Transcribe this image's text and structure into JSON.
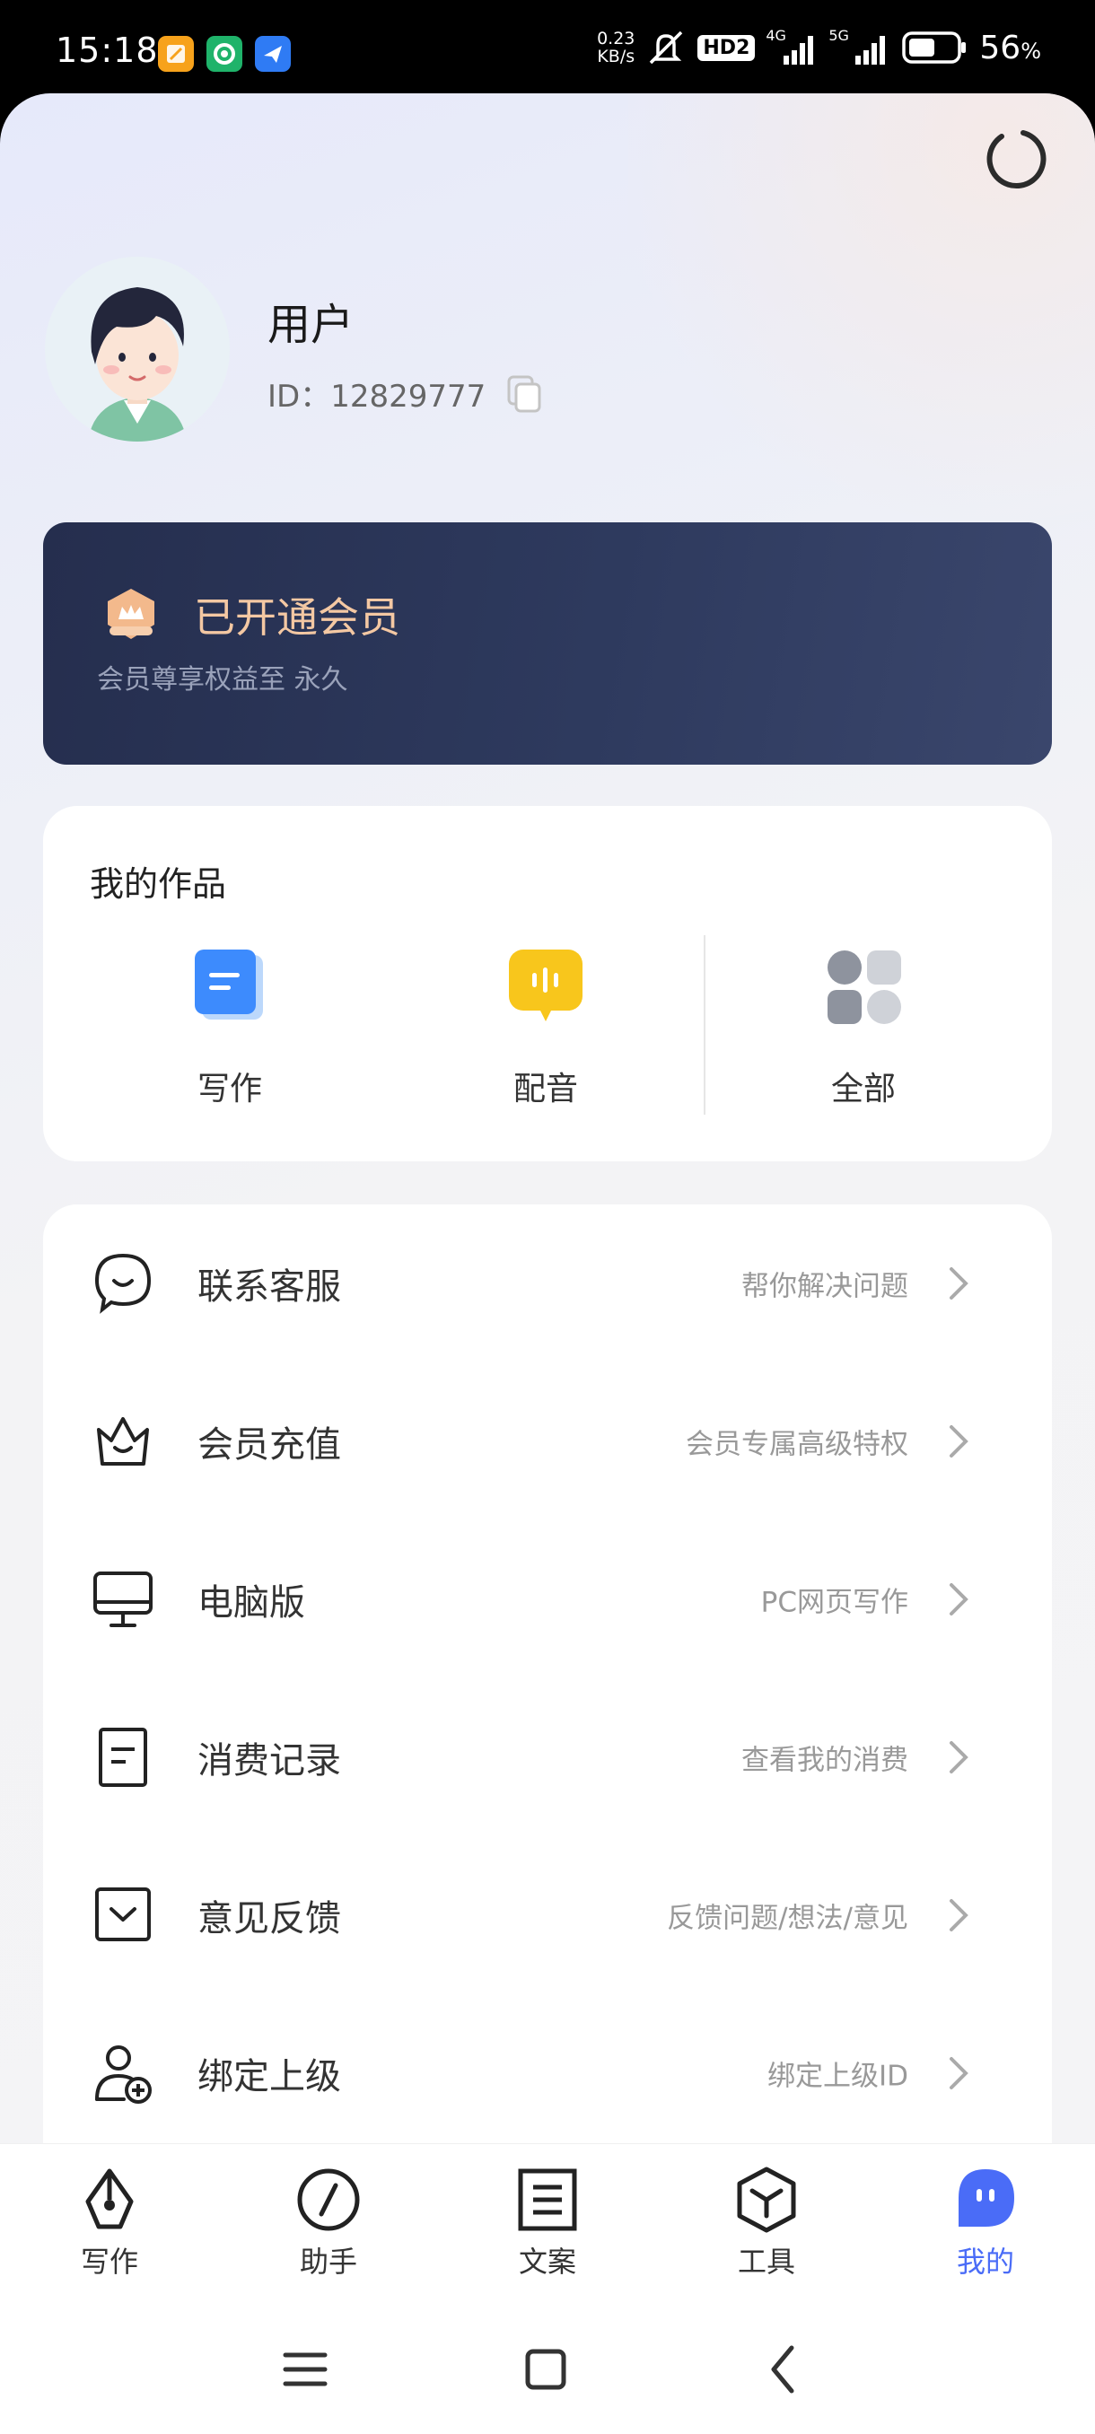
{
  "status_bar": {
    "time": "15:18",
    "net_speed_value": "0.23",
    "net_speed_unit": "KB/s",
    "hd_label": "HD2",
    "sig1_label": "4G",
    "sig2_label": "5G",
    "battery_value": "56",
    "battery_unit": "%",
    "battery_level": 0.56,
    "notification_icons": [
      "orange-app-icon",
      "green-app-icon",
      "blue-app-icon"
    ]
  },
  "profile": {
    "name": "用户",
    "id_text": "ID：12829777"
  },
  "member": {
    "title": "已开通会员",
    "subtitle": "会员尊享权益至 永久"
  },
  "works": {
    "title": "我的作品",
    "items": [
      {
        "label": "写作",
        "icon": "document-icon",
        "color": "#3d8bfd"
      },
      {
        "label": "配音",
        "icon": "audio-bubble-icon",
        "color": "#f8c61c"
      },
      {
        "label": "全部",
        "icon": "grid-icon",
        "color": "#8e939e"
      }
    ]
  },
  "menu": [
    {
      "label": "联系客服",
      "desc": "帮你解决问题",
      "icon": "chat-bubble-icon"
    },
    {
      "label": "会员充值",
      "desc": "会员专属高级特权",
      "icon": "crown-icon"
    },
    {
      "label": "电脑版",
      "desc": "PC网页写作",
      "icon": "monitor-icon"
    },
    {
      "label": "消费记录",
      "desc": "查看我的消费",
      "icon": "receipt-icon"
    },
    {
      "label": "意见反馈",
      "desc": "反馈问题/想法/意见",
      "icon": "feedback-icon"
    },
    {
      "label": "绑定上级",
      "desc": "绑定上级ID",
      "icon": "user-add-icon"
    }
  ],
  "tabs": [
    {
      "label": "写作",
      "icon": "pen-nib-icon",
      "active": false
    },
    {
      "label": "助手",
      "icon": "compass-icon",
      "active": false
    },
    {
      "label": "文案",
      "icon": "document-lines-icon",
      "active": false
    },
    {
      "label": "工具",
      "icon": "cube-icon",
      "active": false
    },
    {
      "label": "我的",
      "icon": "profile-bubble-icon",
      "active": true
    }
  ],
  "colors": {
    "accent": "#4a6cf7",
    "member_card_bg": "#2a3558",
    "member_title": "#f4c8a3"
  }
}
